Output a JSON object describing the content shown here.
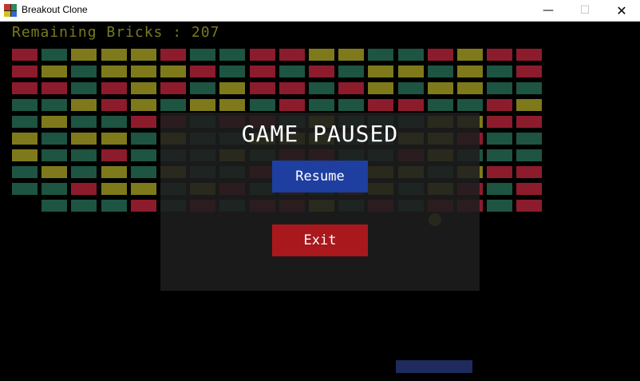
{
  "window": {
    "title": "Breakout Clone",
    "controls": {
      "minimize": "—",
      "maximize": "☐",
      "close": "✕"
    }
  },
  "hud": {
    "remaining_label": "Remaining Bricks : 207"
  },
  "pause_menu": {
    "title": "GAME PAUSED",
    "resume_label": "Resume",
    "exit_label": "Exit"
  },
  "colors": {
    "brick_red": "#8c1c2c",
    "brick_green": "#1d5442",
    "brick_yellow": "#7e7a1b",
    "hud_text": "#7a7a1e",
    "resume_button": "#1e3ea0",
    "exit_button": "#a8181c",
    "paddle": "#1f2a5e",
    "ball": "#6e6a17"
  },
  "bricks": {
    "rows": [
      "RGYYYRGGRRYYGGRYRR",
      "RYGYYYRGRGRGYYGYGR",
      "RRGRYRGYRRGRYGYYGG",
      "GGYRYGYYGRGGRRGGRY",
      "GYGGRRGRRGYGGGYYRR",
      "YGYYGYGGYYYGGYYRGG",
      "YGGRGGGYGRRGGRYGGG",
      "GYGYGYGGRGRGYYGYRR",
      "GGRYYGYRGRGRYGYRGR",
      ".GGGRGRGRRYGRGRRGR"
    ]
  }
}
